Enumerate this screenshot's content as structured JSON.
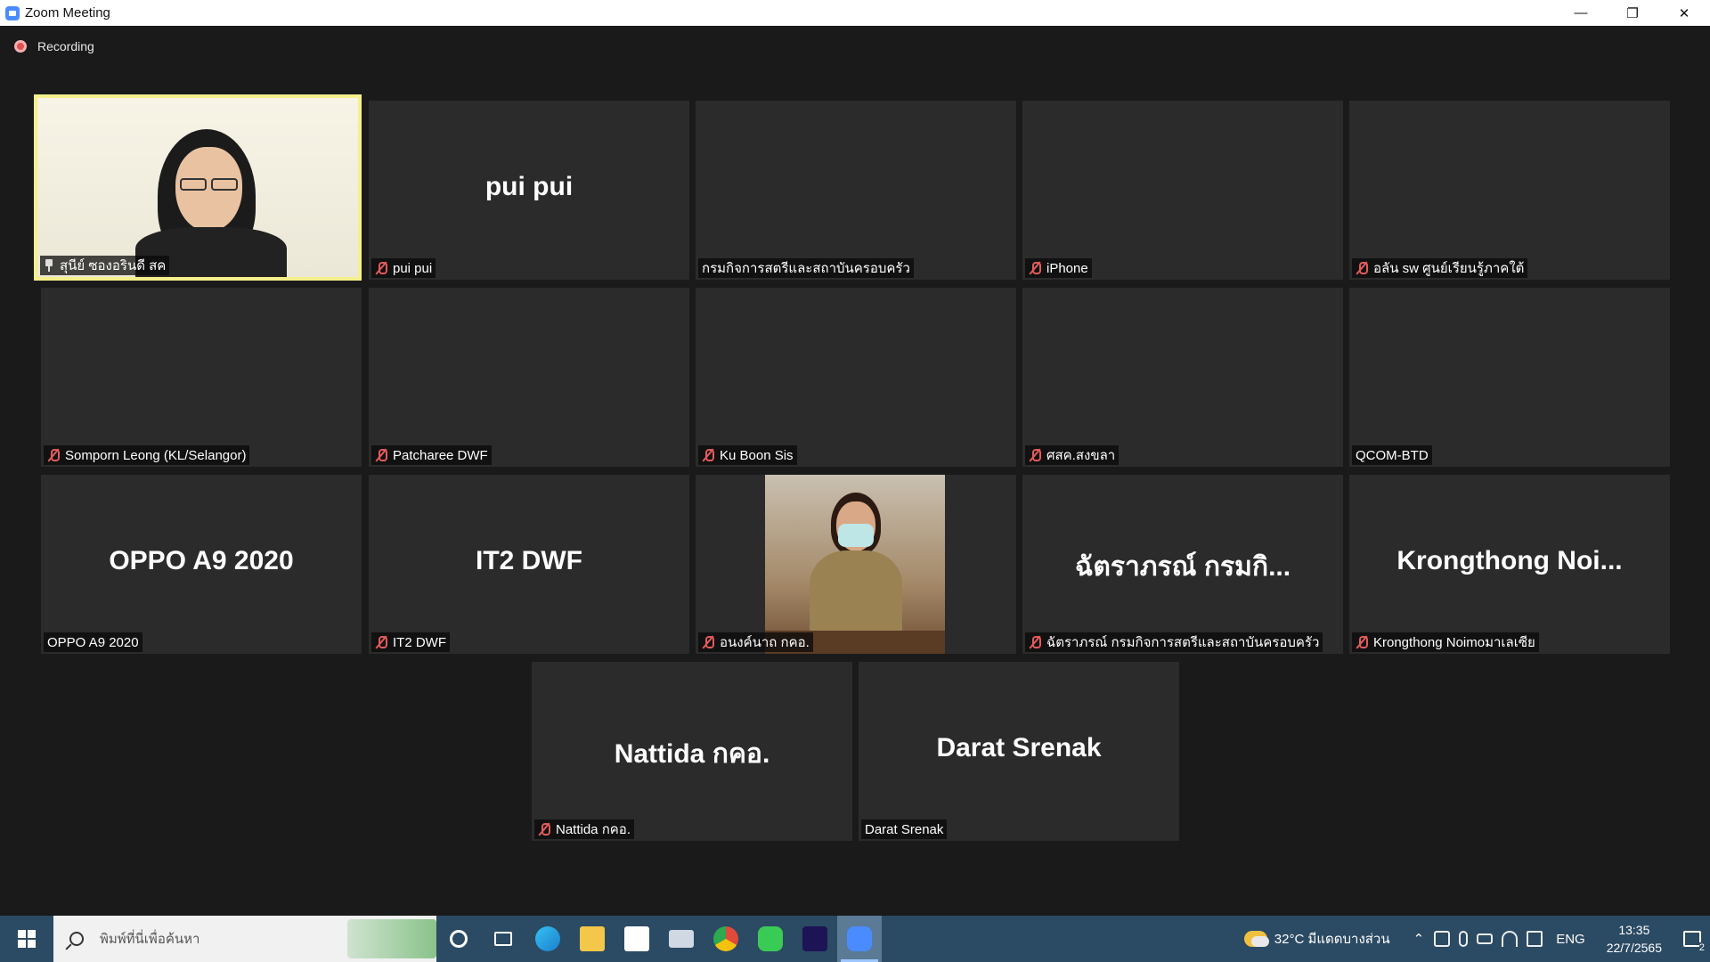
{
  "window": {
    "title": "Zoom Meeting",
    "controls": {
      "minimize": "—",
      "restore": "❐",
      "close": "✕"
    }
  },
  "meeting": {
    "recording_label": "Recording",
    "participants": [
      {
        "label": "สุนีย์ ซองอรินดี สค",
        "big": "",
        "muted": false,
        "pinned": true,
        "video": true,
        "active": true
      },
      {
        "label": "pui pui",
        "big": "pui pui",
        "muted": true
      },
      {
        "label": "กรมกิจการสตรีและสถาบันครอบครัว",
        "big": "",
        "muted": false
      },
      {
        "label": "iPhone",
        "big": "",
        "muted": true
      },
      {
        "label": "อลัน sw ศูนย์เรียนรู้ภาคใต้",
        "big": "",
        "muted": true
      },
      {
        "label": "Somporn Leong (KL/Selangor)",
        "big": "",
        "muted": true
      },
      {
        "label": "Patcharee DWF",
        "big": "",
        "muted": true
      },
      {
        "label": "Ku Boon Sis",
        "big": "",
        "muted": true
      },
      {
        "label": "ศสค.สงขลา",
        "big": "",
        "muted": true
      },
      {
        "label": "QCOM-BTD",
        "big": "",
        "muted": false
      },
      {
        "label": "OPPO A9 2020",
        "big": "OPPO A9 2020",
        "muted": false
      },
      {
        "label": "IT2 DWF",
        "big": "IT2 DWF",
        "muted": true
      },
      {
        "label": "อนงค์นาถ กคอ.",
        "big": "",
        "muted": true,
        "video": true
      },
      {
        "label": "ฉัตราภรณ์ กรมกิจการสตรีและสถาบันครอบครัว",
        "big": "ฉัตราภรณ์ กรมกิ...",
        "muted": true
      },
      {
        "label": "Krongthong Noimoมาเลเซีย",
        "big": "Krongthong  Noi...",
        "muted": true
      },
      {
        "label": "Nattida กคอ.",
        "big": "Nattida กคอ.",
        "muted": true
      },
      {
        "label": "Darat Srenak",
        "big": "Darat Srenak",
        "muted": false
      }
    ]
  },
  "taskbar": {
    "search_placeholder": "พิมพ์ที่นี่เพื่อค้นหา",
    "apps": [
      "cortana-icon",
      "task-view-icon",
      "edge-icon",
      "file-explorer-icon",
      "store-icon",
      "mail-icon",
      "chrome-icon",
      "line-icon",
      "premiere-icon",
      "zoom-icon"
    ],
    "weather": "32°C  มีแดดบางส่วน",
    "language": "ENG",
    "time": "13:35",
    "date": "22/7/2565",
    "notification_count": "2"
  }
}
